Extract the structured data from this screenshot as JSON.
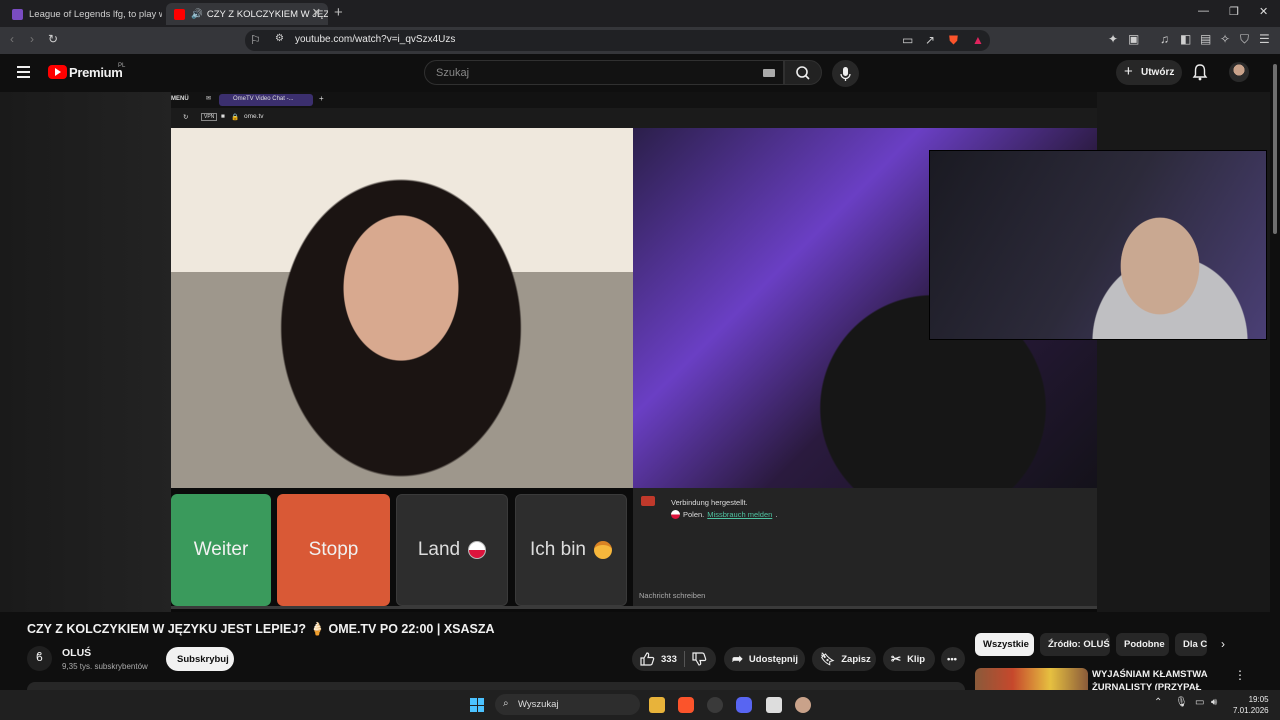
{
  "browser": {
    "tabs": [
      {
        "title": "League of Legends lfg, to play with L",
        "active": false
      },
      {
        "title": "CZY Z KOLCZYKIEM W JĘZYKU",
        "active": true
      }
    ],
    "url": "youtube.com/watch?v=i_qvSzx4Uzs"
  },
  "youtube": {
    "logo_text": "Premium",
    "region": "PL",
    "search_placeholder": "Szukaj",
    "create_label": "Utwórz"
  },
  "player": {
    "inner_tab_title": "OmeTV Video Chat -...",
    "inner_menu": "MENÜ",
    "inner_url": "ome.tv",
    "buttons": {
      "next": "Weiter",
      "stop": "Stopp",
      "country": "Land",
      "gender": "Ich bin"
    },
    "chat": {
      "status": "Verbindung hergestellt.",
      "country": "Polen.",
      "abuse_link": "Missbrauch melden",
      "input_placeholder": "Nachricht schreiben"
    }
  },
  "video": {
    "title": "CZY Z KOLCZYKIEM W JĘZYKU JEST LEPIEJ? 🍦 OME.TV PO 22:00 | XSASZA",
    "channel": "OLUŚ",
    "subscribers": "9,35 tys. subskrybentów",
    "subscribe_label": "Subskrybuj",
    "likes": "333",
    "share_label": "Udostępnij",
    "save_label": "Zapisz",
    "clip_label": "Klip"
  },
  "chips": [
    "Wszystkie",
    "Źródło: OLUŚ",
    "Podobne",
    "Dla Ci"
  ],
  "recommendation": {
    "title": "WYJAŚNIAM KŁAMSTWA ŻURNALISTY (PRZYPAŁ"
  },
  "taskbar": {
    "search_label": "Wyszukaj",
    "time": "19:05",
    "date": "7.01.2026"
  },
  "colors": {
    "youtube_red": "#ff0000",
    "weiter_green": "#3a9a5c",
    "stopp_red": "#d95936",
    "chat_link": "#4fc3a1"
  }
}
